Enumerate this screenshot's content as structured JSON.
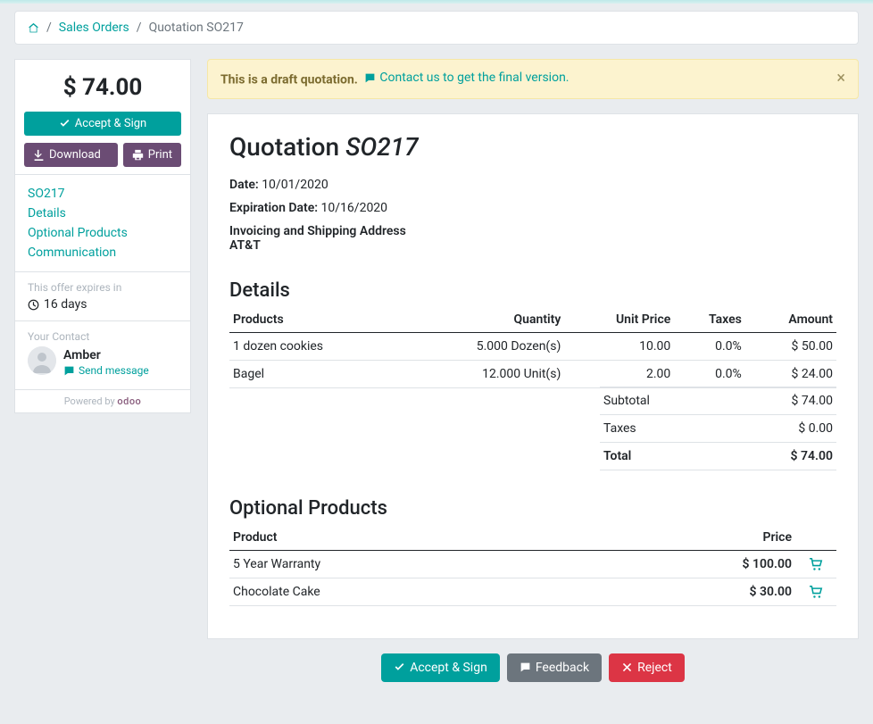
{
  "breadcrumb": {
    "home_label": "Home",
    "sales_orders": "Sales Orders",
    "current": "Quotation SO217"
  },
  "sidebar": {
    "total_price": "$ 74.00",
    "accept_sign": "Accept & Sign",
    "download": "Download",
    "print": "Print",
    "nav": {
      "so": "SO217",
      "details": "Details",
      "optional": "Optional Products",
      "communication": "Communication"
    },
    "expires_label": "This offer expires in",
    "expires_value": "16 days",
    "contact_label": "Your Contact",
    "contact_name": "Amber",
    "send_message": "Send message",
    "powered_prefix": "Powered by ",
    "powered_brand": "odoo"
  },
  "alert": {
    "prefix": "This is a draft quotation.",
    "link": "Contact us to get the final version."
  },
  "quotation": {
    "title_prefix": "Quotation ",
    "title_number": "SO217",
    "date_label": "Date:",
    "date_value": "10/01/2020",
    "expiration_label": "Expiration Date:",
    "expiration_value": "10/16/2020",
    "address_label": "Invoicing and Shipping Address",
    "address_name": "AT&T"
  },
  "details": {
    "heading": "Details",
    "headers": {
      "products": "Products",
      "quantity": "Quantity",
      "unit_price": "Unit Price",
      "taxes": "Taxes",
      "amount": "Amount"
    },
    "rows": [
      {
        "product": "1 dozen cookies",
        "quantity": "5.000 Dozen(s)",
        "unit_price": "10.00",
        "taxes": "0.0%",
        "amount": "$ 50.00"
      },
      {
        "product": "Bagel",
        "quantity": "12.000 Unit(s)",
        "unit_price": "2.00",
        "taxes": "0.0%",
        "amount": "$ 24.00"
      }
    ],
    "totals": {
      "subtotal_label": "Subtotal",
      "subtotal": "$ 74.00",
      "taxes_label": "Taxes",
      "taxes": "$ 0.00",
      "total_label": "Total",
      "total": "$ 74.00"
    }
  },
  "optional": {
    "heading": "Optional Products",
    "headers": {
      "product": "Product",
      "price": "Price"
    },
    "rows": [
      {
        "product": "5 Year Warranty",
        "price": "$ 100.00"
      },
      {
        "product": "Chocolate Cake",
        "price": "$ 30.00"
      }
    ]
  },
  "footer": {
    "accept_sign": "Accept & Sign",
    "feedback": "Feedback",
    "reject": "Reject"
  }
}
